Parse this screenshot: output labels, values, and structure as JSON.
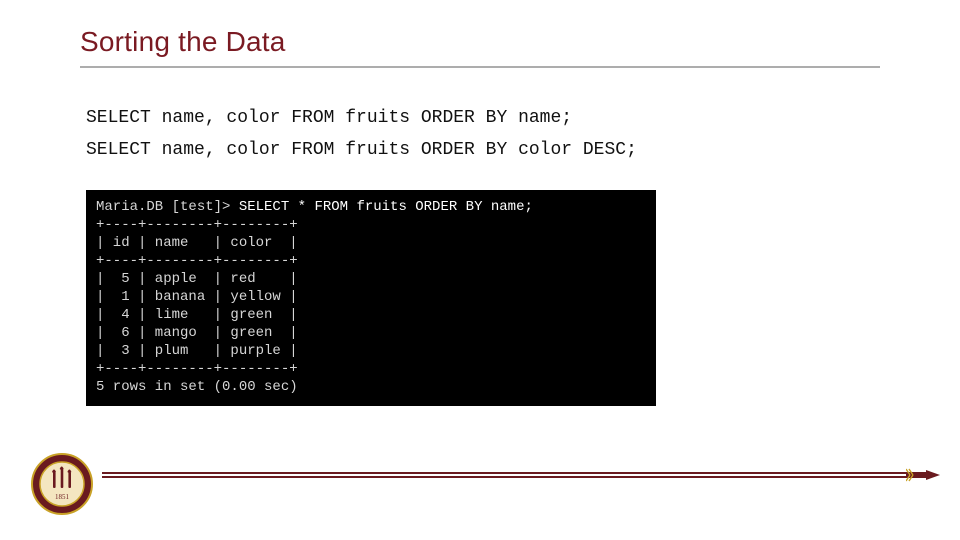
{
  "slide": {
    "title": "Sorting the Data",
    "code_lines": [
      "SELECT name, color FROM fruits ORDER BY name;",
      "SELECT name, color FROM fruits ORDER BY color DESC;"
    ]
  },
  "terminal": {
    "prompt_db": "Maria.DB [test]> ",
    "command": "SELECT * FROM fruits ORDER BY name;",
    "border_top": "+----+--------+--------+",
    "header_row": "| id | name   | color  |",
    "rows": [
      "|  5 | apple  | red    |",
      "|  1 | banana | yellow |",
      "|  4 | lime   | green  |",
      "|  6 | mango  | green  |",
      "|  3 | plum   | purple |"
    ],
    "footer_line": "5 rows in set (0.00 sec)"
  },
  "chart_data": {
    "type": "table",
    "title": "fruits ORDER BY name",
    "columns": [
      "id",
      "name",
      "color"
    ],
    "rows": [
      {
        "id": 5,
        "name": "apple",
        "color": "red"
      },
      {
        "id": 1,
        "name": "banana",
        "color": "yellow"
      },
      {
        "id": 4,
        "name": "lime",
        "color": "green"
      },
      {
        "id": 6,
        "name": "mango",
        "color": "green"
      },
      {
        "id": 3,
        "name": "plum",
        "color": "purple"
      }
    ],
    "row_count": 5,
    "elapsed_sec": 0.0
  },
  "branding": {
    "institution": "Florida State University",
    "seal_year": "1851",
    "colors": {
      "garnet": "#6a1a1f",
      "gold": "#c9a227"
    }
  }
}
